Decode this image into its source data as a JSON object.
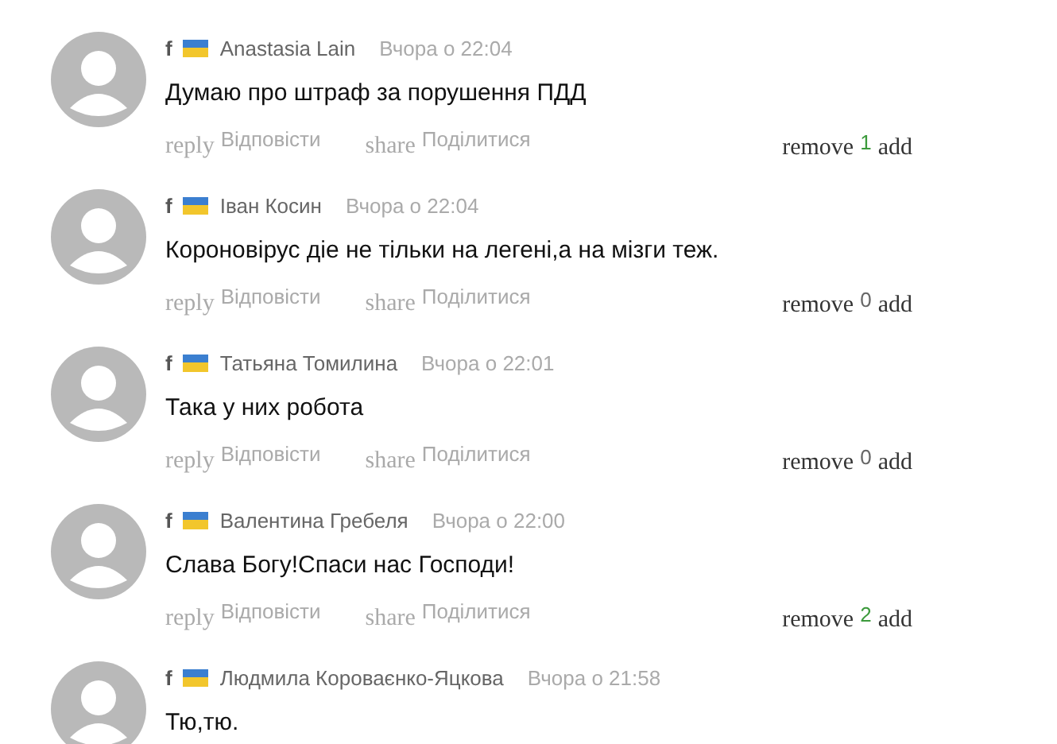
{
  "comments": [
    {
      "source": "f",
      "author": "Anastasia Lain",
      "time": "Вчора о 22:04",
      "text": "Думаю про штраф за порушення ПДД",
      "actions": {
        "reply_icon": "reply",
        "reply": "Відповісти",
        "share_icon": "share",
        "share": "Поділитися",
        "remove": "remove",
        "score": {
          "value": "1",
          "color": "#3c9a3c"
        },
        "add": "add"
      }
    },
    {
      "source": "f",
      "author": "Іван Косин",
      "time": "Вчора о 22:04",
      "text": "Короновірус діе не тільки на легені,а на мізги теж.",
      "actions": {
        "reply_icon": "reply",
        "reply": "Відповісти",
        "share_icon": "share",
        "share": "Поділитися",
        "remove": "remove",
        "score": {
          "value": "0",
          "color": "#666666"
        },
        "add": "add"
      }
    },
    {
      "source": "f",
      "author": "Татьяна Томилина",
      "time": "Вчора о 22:01",
      "text": "Така у них робота",
      "actions": {
        "reply_icon": "reply",
        "reply": "Відповісти",
        "share_icon": "share",
        "share": "Поділитися",
        "remove": "remove",
        "score": {
          "value": "0",
          "color": "#666666"
        },
        "add": "add"
      }
    },
    {
      "source": "f",
      "author": "Валентина Гребеля",
      "time": "Вчора о 22:00",
      "text": "Слава Богу!Спаси нас Господи!",
      "actions": {
        "reply_icon": "reply",
        "reply": "Відповісти",
        "share_icon": "share",
        "share": "Поділитися",
        "remove": "remove",
        "score": {
          "value": "2",
          "color": "#3c9a3c"
        },
        "add": "add"
      }
    },
    {
      "source": "f",
      "author": "Людмила Короваєнко-Яцкова",
      "time": "Вчора о 21:58",
      "text": "Тю,тю."
    }
  ]
}
